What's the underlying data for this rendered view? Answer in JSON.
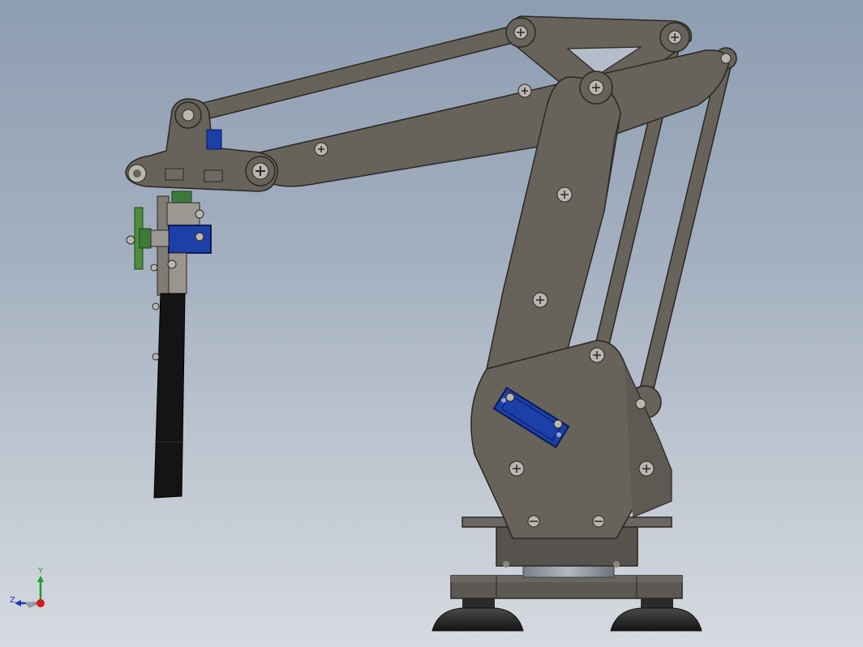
{
  "viewport": {
    "background_top": "#8d9db1",
    "background_bottom": "#d6dae0"
  },
  "model": {
    "part_color": "#67625a",
    "part_edge": "#2a2824",
    "servo_color": "#1c3fa8",
    "gripper_color": "#111111",
    "base_color": "#5f5c57",
    "suction_cup_color": "#2a2a2a",
    "hole_color": "#b9b6b0"
  },
  "triad": {
    "y_label": "Y",
    "z_label": "Z",
    "x_color": "#d11d1d",
    "y_color": "#1c9d2b",
    "z_color": "#1c35b8"
  }
}
